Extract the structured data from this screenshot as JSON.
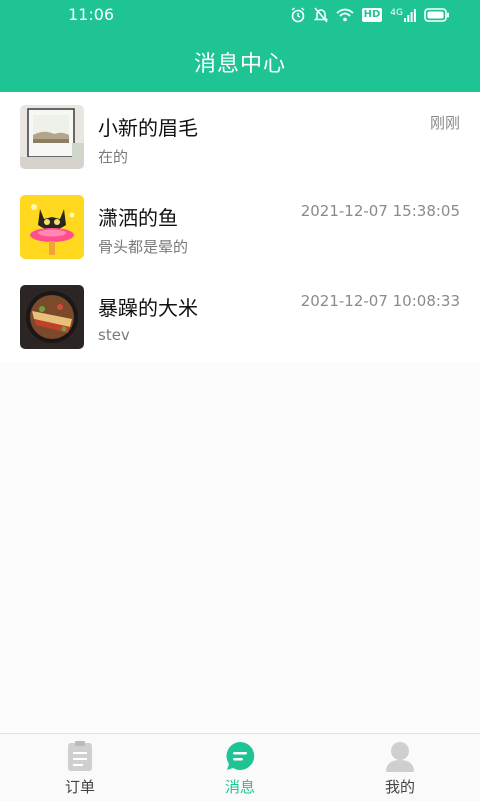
{
  "status_bar": {
    "time": "11:06",
    "hd_label": "HD",
    "network_label": "4G"
  },
  "header": {
    "title": "消息中心"
  },
  "messages": [
    {
      "name": "小新的眉毛",
      "preview": "在的",
      "time": "刚刚",
      "avatar": "room-photo-avatar"
    },
    {
      "name": "潇洒的鱼",
      "preview": "骨头都是晕的",
      "time": "2021-12-07 15:38:05",
      "avatar": "cartoon-cat-avatar"
    },
    {
      "name": "暴躁的大米",
      "preview": "stev",
      "time": "2021-12-07 10:08:33",
      "avatar": "food-pan-avatar"
    }
  ],
  "tabbar": {
    "tabs": [
      {
        "label": "订单",
        "icon": "clipboard-icon",
        "active": false
      },
      {
        "label": "消息",
        "icon": "chat-bubble-icon",
        "active": true
      },
      {
        "label": "我的",
        "icon": "user-icon",
        "active": false
      }
    ]
  },
  "colors": {
    "accent": "#1fc495",
    "inactive_icon": "#cfcfcf",
    "background": "#fcfcfc"
  }
}
